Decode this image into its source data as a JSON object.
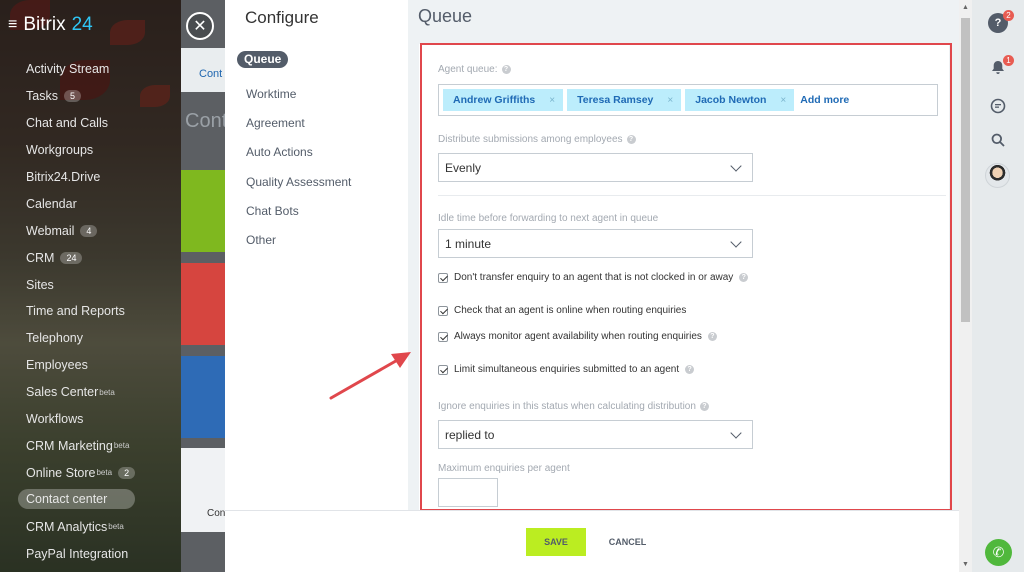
{
  "brand": {
    "name": "Bitrix",
    "number": "24"
  },
  "sidebar": {
    "items": [
      {
        "label": "Activity Stream",
        "count": ""
      },
      {
        "label": "Tasks",
        "count": "5"
      },
      {
        "label": "Chat and Calls",
        "count": ""
      },
      {
        "label": "Workgroups",
        "count": ""
      },
      {
        "label": "Bitrix24.Drive",
        "count": ""
      },
      {
        "label": "Calendar",
        "count": ""
      },
      {
        "label": "Webmail",
        "count": "4"
      },
      {
        "label": "CRM",
        "count": "24"
      },
      {
        "label": "Sites",
        "count": ""
      },
      {
        "label": "Time and Reports",
        "count": ""
      },
      {
        "label": "Telephony",
        "count": ""
      },
      {
        "label": "Employees",
        "count": ""
      },
      {
        "label": "Sales Center",
        "sup": "beta",
        "count": ""
      },
      {
        "label": "Workflows",
        "count": ""
      },
      {
        "label": "CRM Marketing",
        "sup": "beta",
        "count": ""
      },
      {
        "label": "Online Store",
        "sup": "beta",
        "count": "2"
      },
      {
        "label": "Contact center",
        "count": "",
        "active": true
      },
      {
        "label": "CRM Analytics",
        "sup": "beta",
        "count": ""
      },
      {
        "label": "PayPal Integration",
        "count": ""
      }
    ]
  },
  "peek": {
    "tab": "Cont",
    "title": "Cont",
    "foot": "Con"
  },
  "configure": {
    "title": "Configure",
    "menu": [
      "Queue",
      "Worktime",
      "Agreement",
      "Auto Actions",
      "Quality Assessment",
      "Chat Bots",
      "Other"
    ]
  },
  "queue": {
    "title": "Queue",
    "agent_queue_label": "Agent queue:",
    "agents": [
      "Andrew Griffiths",
      "Teresa Ramsey",
      "Jacob Newton"
    ],
    "tag_remove": "×",
    "add_more": "Add more",
    "distribute_label": "Distribute submissions among employees",
    "distribute_value": "Evenly",
    "idle_label": "Idle time before forwarding to next agent in queue",
    "idle_value": "1 minute",
    "checkboxes": [
      "Don't transfer enquiry to an agent that is not clocked in or away",
      "Check that an agent is online when routing enquiries",
      "Always monitor agent availability when routing enquiries",
      "Limit simultaneous enquiries submitted to an agent"
    ],
    "ignore_label": "Ignore enquiries in this status when calculating distribution",
    "ignore_value": "replied to",
    "max_label": "Maximum enquiries per agent",
    "max_value": ""
  },
  "footer": {
    "save": "SAVE",
    "cancel": "CANCEL"
  },
  "rail": {
    "help_badge": "2",
    "notify_badge": "1"
  },
  "colors": {
    "accent": "#2fc6f6",
    "save": "#bbed21",
    "highlight": "#e0474c",
    "tag": "#bcedfc",
    "phone": "#50b83c"
  }
}
